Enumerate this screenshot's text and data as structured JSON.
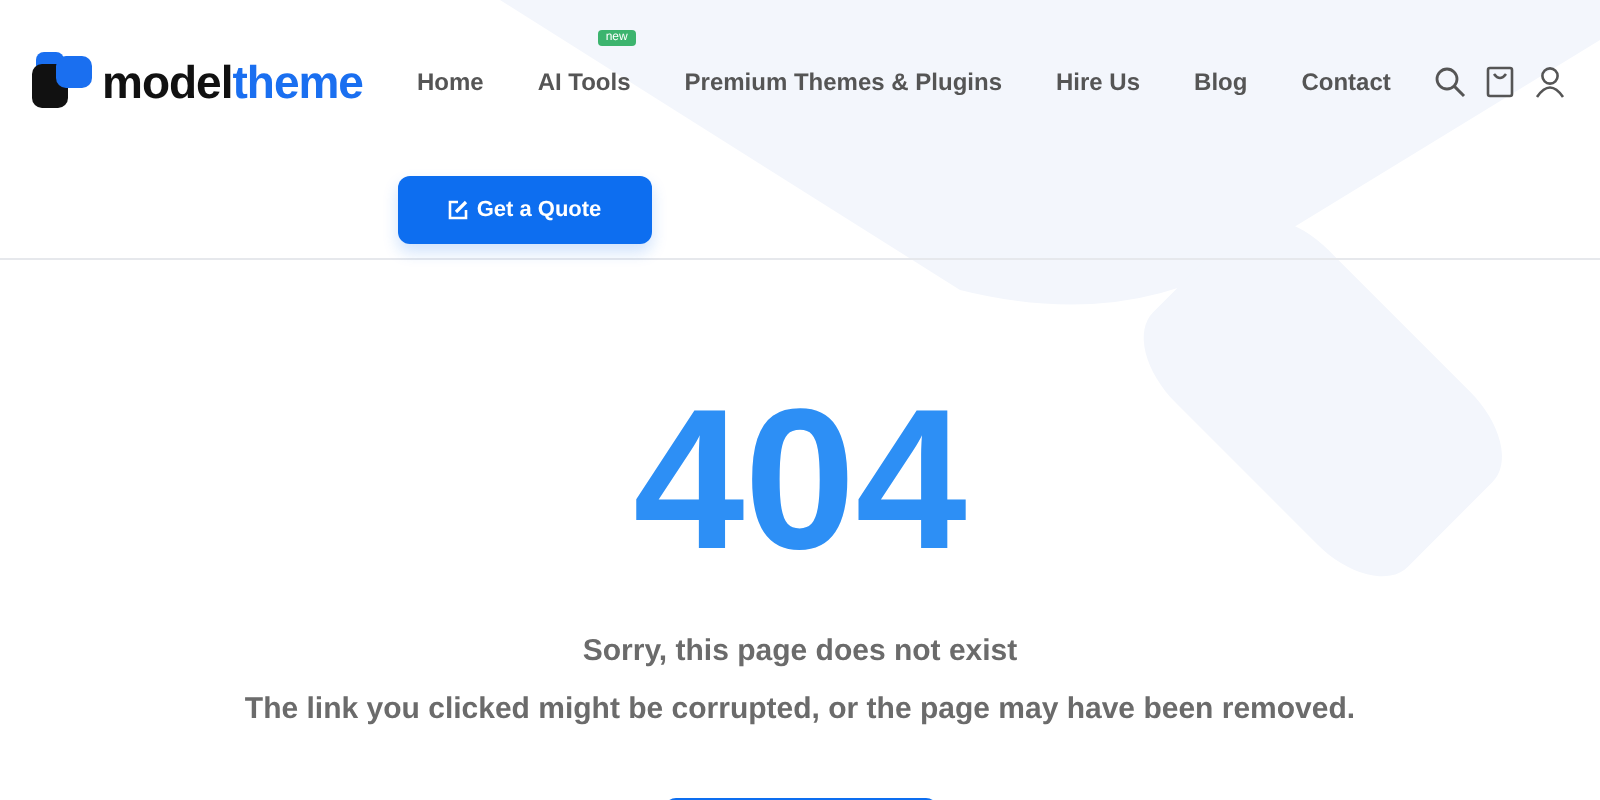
{
  "logo": {
    "dark": "model",
    "accent": "theme"
  },
  "nav": [
    {
      "label": "Home"
    },
    {
      "label": "AI Tools",
      "badge": "new"
    },
    {
      "label": "Premium Themes & Plugins"
    },
    {
      "label": "Hire Us"
    },
    {
      "label": "Blog"
    },
    {
      "label": "Contact"
    }
  ],
  "quote_button": {
    "label": "Get a Quote"
  },
  "error": {
    "code": "404",
    "title": "Sorry, this page does not exist",
    "message": "The link you clicked might be corrupted, or the page may have been removed."
  }
}
